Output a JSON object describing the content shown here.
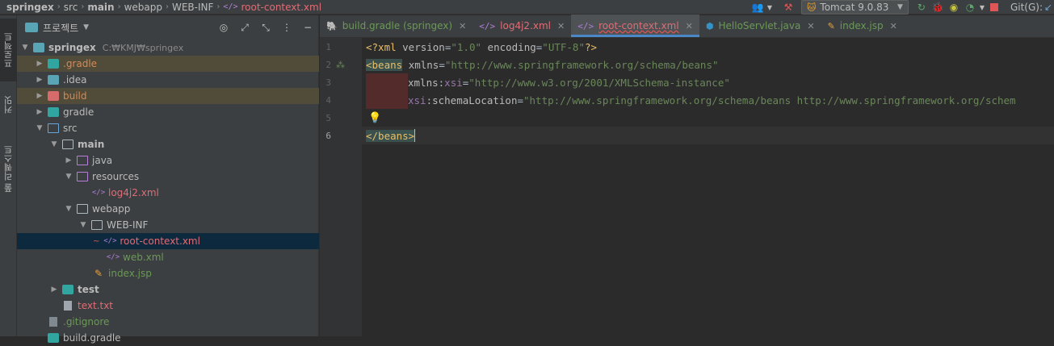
{
  "breadcrumb": [
    "springex",
    "src",
    "main",
    "webapp",
    "WEB-INF",
    "root-context.xml"
  ],
  "toolbar": {
    "run_config": "Tomcat 9.0.83",
    "git_label": "Git(G):"
  },
  "side_tabs": [
    "프로젝트",
    "커밋",
    "풀 리퀘스트"
  ],
  "project_panel": {
    "title": "프로젝트",
    "tree": [
      {
        "name": "springex",
        "extra": "C:₩KMJ₩springex"
      },
      {
        "name": ".gradle"
      },
      {
        "name": ".idea"
      },
      {
        "name": "build"
      },
      {
        "name": "gradle"
      },
      {
        "name": "src"
      },
      {
        "name": "main"
      },
      {
        "name": "java"
      },
      {
        "name": "resources"
      },
      {
        "name": "log4j2.xml"
      },
      {
        "name": "webapp"
      },
      {
        "name": "WEB-INF"
      },
      {
        "name": "root-context.xml"
      },
      {
        "name": "web.xml"
      },
      {
        "name": "index.jsp"
      },
      {
        "name": "test"
      },
      {
        "name": "text.txt"
      },
      {
        "name": ".gitignore"
      },
      {
        "name": "build.gradle"
      }
    ]
  },
  "tabs": [
    {
      "label": "build.gradle (springex)"
    },
    {
      "label": "log4j2.xml"
    },
    {
      "label": "root-context.xml"
    },
    {
      "label": "HelloServlet.java"
    },
    {
      "label": "index.jsp"
    }
  ],
  "code": {
    "line_numbers": [
      "1",
      "2",
      "3",
      "4",
      "5",
      "6"
    ],
    "l1": {
      "a": "<?xml ",
      "b": "version",
      "c": "=",
      "d": "\"1.0\"",
      "e": " ",
      "f": "encoding",
      "g": "=",
      "h": "\"UTF-8\"",
      "i": "?>"
    },
    "l2": {
      "a": "<beans",
      "b": " ",
      "c": "xmlns",
      "d": "=",
      "e": "\"http://www.springframework.org/schema/beans\""
    },
    "l3": {
      "a": "xmlns",
      "b": ":",
      "c": "xsi",
      "d": "=",
      "e": "\"http://www.w3.org/2001/XMLSchema-instance\""
    },
    "l4": {
      "a": "xsi",
      "b": ":",
      "c": "schemaLocation",
      "d": "=",
      "e": "\"http://www.springframework.org/schema/beans http://www.springframework.org/schem"
    },
    "l6": {
      "a": "</beans>"
    }
  }
}
